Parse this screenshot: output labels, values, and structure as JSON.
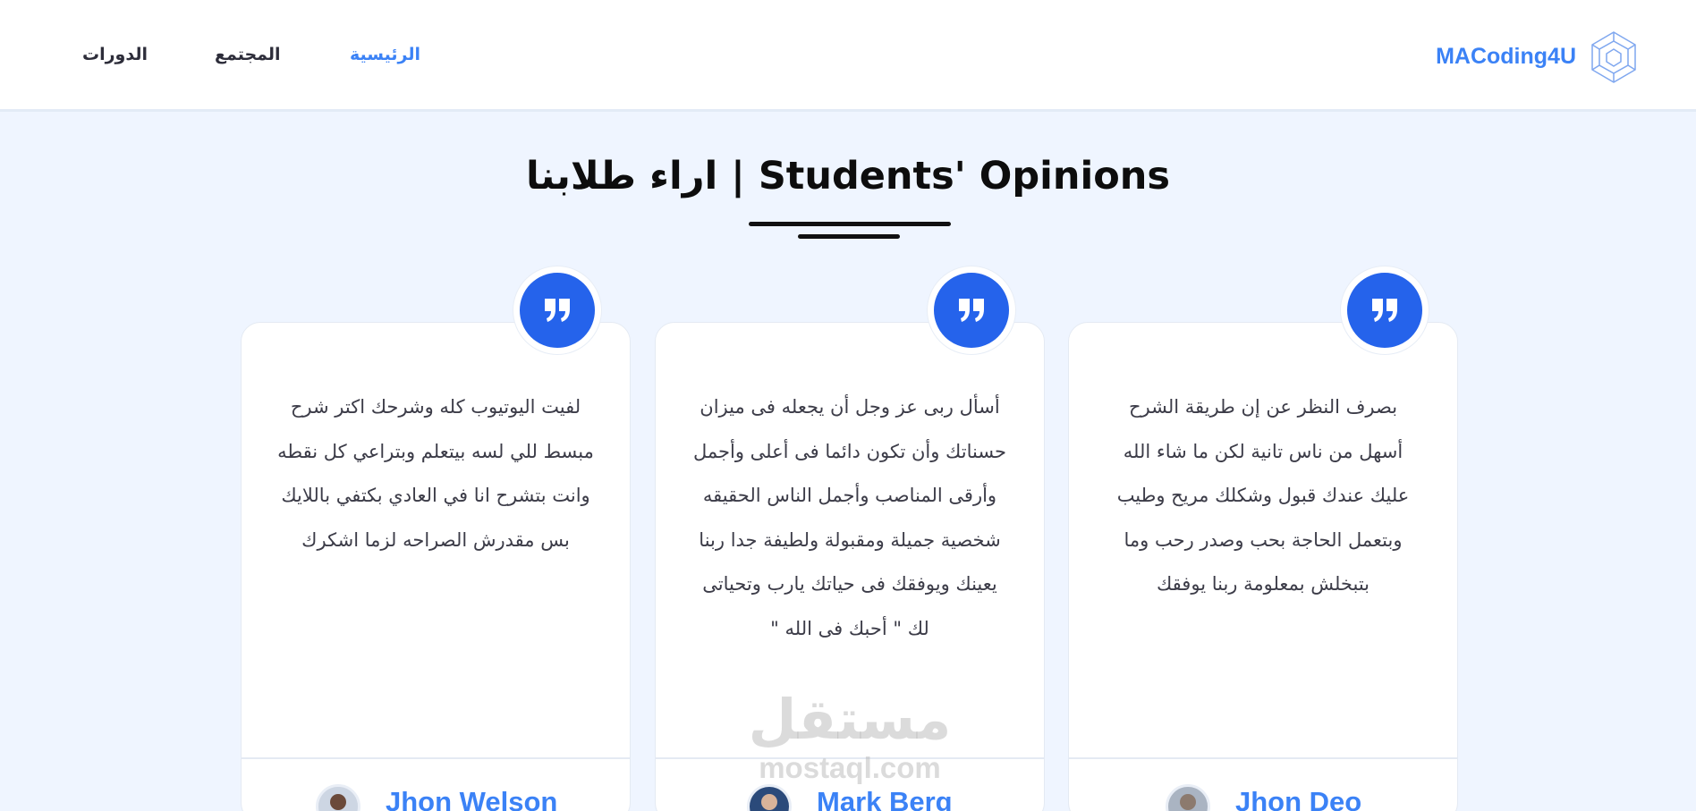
{
  "nav": {
    "links": [
      {
        "label": "الدورات"
      },
      {
        "label": "المجتمع"
      },
      {
        "label": "الرئيسية"
      }
    ],
    "brand": "MACoding4U"
  },
  "section": {
    "title": "اراء طلابنا | Students' Opinions"
  },
  "testimonials": [
    {
      "text": "لفيت اليوتيوب كله وشرحك اكتر شرح مبسط للي لسه بيتعلم وبتراعي كل نقطه وانت بتشرح انا في العادي بكتفي باللايك بس مقدرش الصراحه لزما اشكرك",
      "name": "Jhon Welson"
    },
    {
      "text": "أسأل ربى عز وجل أن يجعله فى ميزان حسناتك وأن تكون دائما فى أعلى وأجمل وأرقى المناصب وأجمل الناس الحقيقه شخصية جميلة ومقبولة ولطيفة جدا ربنا يعينك ويوفقك فى حياتك يارب وتحياتى لك \" أحبك فى الله \"",
      "name": "Mark Berg"
    },
    {
      "text": "بصرف النظر عن إن طريقة الشرح أسهل من ناس تانية لكن ما شاء الله عليك عندك قبول وشكلك مريح وطيب وبتعمل الحاجة بحب وصدر رحب وما بتبخلش بمعلومة ربنا يوفقك",
      "name": "Jhon Deo"
    }
  ],
  "watermark": {
    "arabic": "مستقل",
    "latin": "mostaql.com"
  },
  "colors": {
    "accent": "#3b82f6",
    "badge": "#2563eb",
    "background": "#eff5ff"
  }
}
